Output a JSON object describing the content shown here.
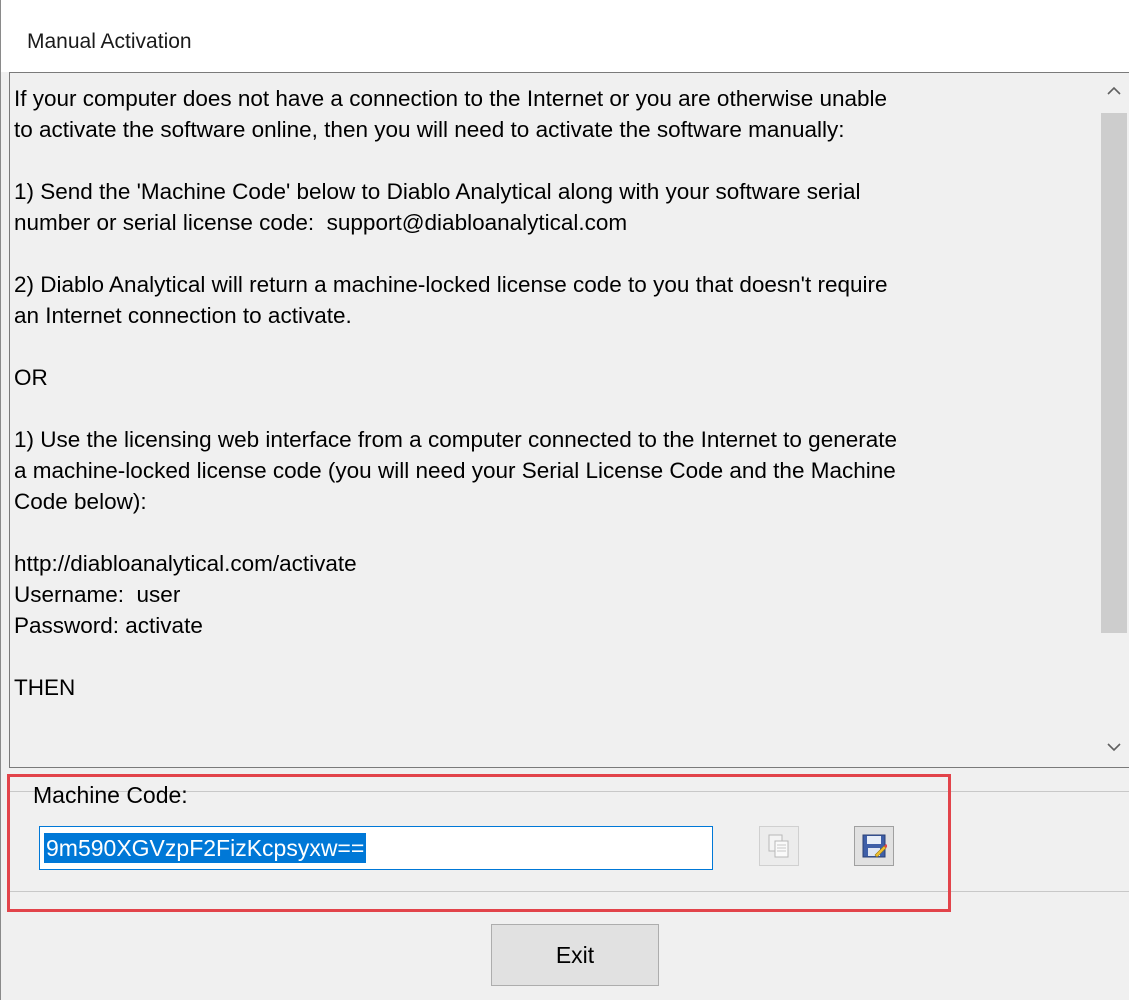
{
  "window": {
    "title": "Manual Activation"
  },
  "instructions": {
    "lines": [
      "If your computer does not have a connection to the Internet or you are otherwise unable",
      "to activate the software online, then you will need to activate the software manually:",
      "",
      "1) Send the 'Machine Code' below to Diablo Analytical along with your software serial",
      "number or serial license code:  support@diabloanalytical.com",
      "",
      "2) Diablo Analytical will return a machine-locked license code to you that doesn't require",
      "an Internet connection to activate.",
      "",
      "OR",
      "",
      "1) Use the licensing web interface from a computer connected to the Internet to generate",
      "a machine-locked license code (you will need your Serial License Code and the Machine",
      "Code below):",
      "",
      "http://diabloanalytical.com/activate",
      "Username:  user",
      "Password: activate",
      "",
      "THEN"
    ]
  },
  "machine_code": {
    "label": "Machine Code:",
    "value": "9m590XGVzpF2FizKcpsyxw=="
  },
  "buttons": {
    "exit": "Exit"
  },
  "icons": {
    "copy": "copy-icon",
    "save": "save-icon",
    "scroll_up": "chevron-up-icon",
    "scroll_down": "chevron-down-icon"
  },
  "colors": {
    "highlight_border": "#e2434a",
    "selection": "#0078d7"
  }
}
